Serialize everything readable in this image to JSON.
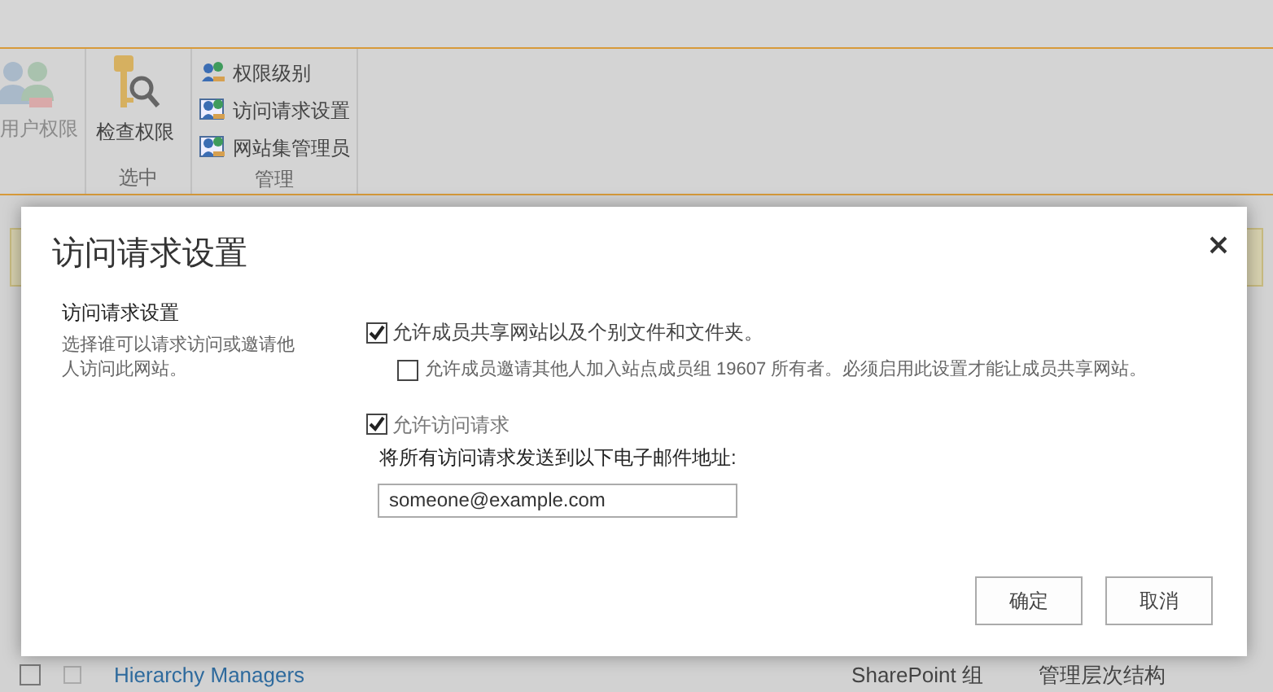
{
  "ribbon": {
    "groups": [
      {
        "items": [
          {
            "label": "用户权限",
            "kind": "large",
            "disabled": true
          }
        ]
      },
      {
        "label": "选中",
        "items": [
          {
            "label": "检查权限",
            "kind": "large",
            "disabled": false
          }
        ]
      },
      {
        "label": "管理",
        "items": [
          {
            "label": "权限级别",
            "kind": "small",
            "disabled": false
          },
          {
            "label": "访问请求设置",
            "kind": "small",
            "disabled": false
          },
          {
            "label": "网站集管理员",
            "kind": "small",
            "disabled": false
          }
        ]
      }
    ]
  },
  "list_row": {
    "select_all_checked": false,
    "checked": false,
    "name": "Hierarchy Managers",
    "type": "SharePoint 组",
    "description": "管理层次结构"
  },
  "dialog": {
    "title": "访问请求设置",
    "section": {
      "title": "访问请求设置",
      "description": "选择谁可以请求访问或邀请他人访问此网站。"
    },
    "options": [
      {
        "label": "允许成员共享网站以及个别文件和文件夹。",
        "checked": true,
        "disabled": false,
        "children": [
          {
            "label": "允许成员邀请其他人加入站点成员组 19607 所有者。必须启用此设置才能让成员共享网站。",
            "checked": false,
            "disabled": false
          }
        ]
      },
      {
        "label": "允许访问请求",
        "checked": true,
        "disabled": true
      }
    ],
    "email": {
      "label": "将所有访问请求发送到以下电子邮件地址:",
      "value": "someone@example.com"
    },
    "buttons": [
      {
        "label": "确定"
      },
      {
        "label": "取消"
      }
    ]
  }
}
